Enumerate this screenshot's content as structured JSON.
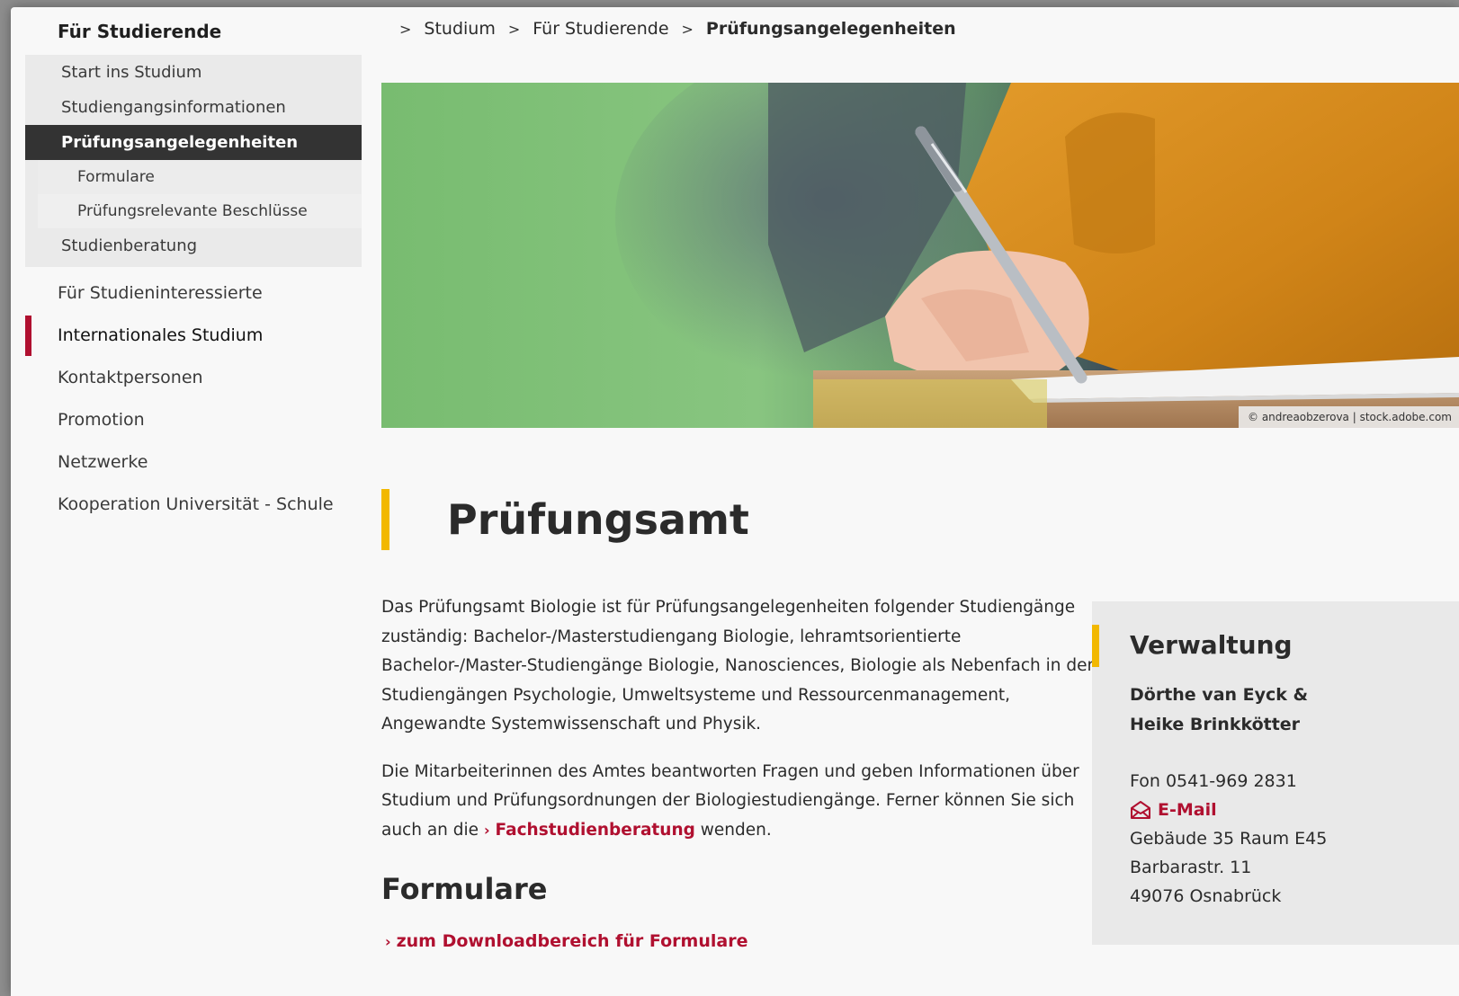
{
  "sidebar": {
    "section_title": "Für Studierende",
    "sub_items": [
      {
        "label": "Start ins Studium"
      },
      {
        "label": "Studiengangsinformationen"
      },
      {
        "label": "Prüfungsangelegenheiten",
        "active": true
      }
    ],
    "subsub_items": [
      {
        "label": "Formulare"
      },
      {
        "label": "Prüfungsrelevante Beschlüsse"
      }
    ],
    "after_sub": "Studienberatung",
    "main_items": [
      {
        "label": "Für Studieninteressierte"
      },
      {
        "label": "Internationales Studium",
        "marked": true
      },
      {
        "label": "Kontaktpersonen"
      },
      {
        "label": "Promotion"
      },
      {
        "label": "Netzwerke"
      },
      {
        "label": "Kooperation Universität - Schule"
      }
    ]
  },
  "breadcrumb": {
    "separator": ">",
    "items": [
      "Studium",
      "Für Studierende",
      "Prüfungsangelegenheiten"
    ]
  },
  "hero": {
    "credit": "© andreaobzerova | stock.adobe.com"
  },
  "main": {
    "title": "Prüfungsamt",
    "paragraph1": "Das Prüfungsamt Biologie ist für Prüfungsangelegenheiten folgender Studiengänge zuständig: Bachelor-/Masterstudiengang Biologie, lehramtsorientierte Bachelor-/Master-Studiengänge Biologie, Nanosciences, Biologie als Nebenfach in den Studiengängen Psychologie, Umweltsysteme und Ressourcenmanagement, Angewandte Systemwissenschaft und Physik.",
    "paragraph2_before": "Die Mitarbeiterinnen des Amtes beantworten Fragen und geben Informationen über Studium und Prüfungsordnungen der Biologiestudiengänge. Ferner können Sie sich auch an die ",
    "paragraph2_link": "Fachstudienberatung",
    "paragraph2_after": " wenden.",
    "forms_heading": "Formulare",
    "forms_link": "zum Downloadbereich für Formulare"
  },
  "contact": {
    "title": "Verwaltung",
    "name1": "Dörthe van Eyck &",
    "name2": "Heike Brinkkötter",
    "phone": "Fon 0541-969 2831",
    "email_label": "E-Mail",
    "room": "Gebäude 35 Raum E45",
    "street": "Barbarastr. 11",
    "city": "49076 Osnabrück"
  },
  "colors": {
    "accent_red": "#b01030",
    "accent_yellow": "#f2b800",
    "active_bg": "#333333"
  },
  "icons": {
    "chevron": "chevron-right-icon",
    "mail": "envelope-icon"
  }
}
